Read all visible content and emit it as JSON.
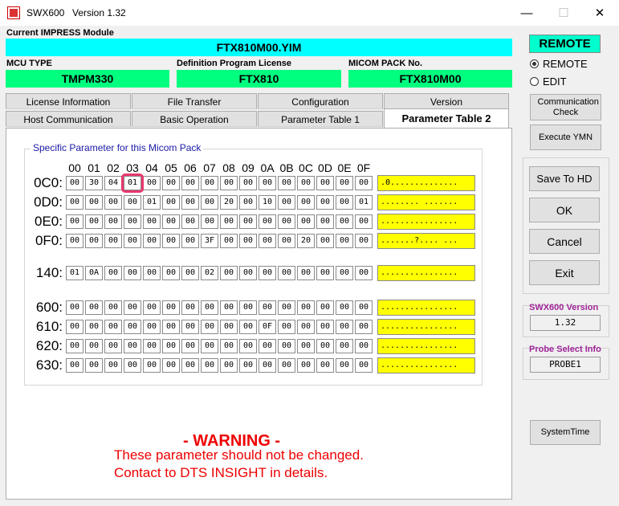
{
  "window": {
    "app_name": "SWX600",
    "version_text": "Version  1.32",
    "minimize": "—",
    "maximize": "☐",
    "close": "✕"
  },
  "impress": {
    "label": "Current IMPRESS Module",
    "value": "FTX810M00.YIM"
  },
  "mcu": {
    "label": "MCU TYPE",
    "value": "TMPM330"
  },
  "license": {
    "label": "Definition Program License",
    "value": "FTX810"
  },
  "micom": {
    "label": "MICOM PACK No.",
    "value": "FTX810M00"
  },
  "tabs_row1": [
    "License Information",
    "File Transfer",
    "Configuration",
    "Version"
  ],
  "tabs_row2": [
    "Host Communication",
    "Basic Operation",
    "Parameter Table 1",
    "Parameter Table 2"
  ],
  "group_title": "Specific Parameter for this Micom Pack",
  "col_headers": [
    "00",
    "01",
    "02",
    "03",
    "04",
    "05",
    "06",
    "07",
    "08",
    "09",
    "0A",
    "0B",
    "0C",
    "0D",
    "0E",
    "0F"
  ],
  "rows": [
    {
      "label": "0C0:",
      "cells": [
        "00",
        "30",
        "04",
        "01",
        "00",
        "00",
        "00",
        "00",
        "00",
        "00",
        "00",
        "00",
        "00",
        "00",
        "00",
        "00"
      ],
      "ascii": ".0..............",
      "highlight": 3
    },
    {
      "label": "0D0:",
      "cells": [
        "00",
        "00",
        "00",
        "00",
        "01",
        "00",
        "00",
        "00",
        "20",
        "00",
        "10",
        "00",
        "00",
        "00",
        "00",
        "01"
      ],
      "ascii": "........ .......",
      "highlight": -1
    },
    {
      "label": "0E0:",
      "cells": [
        "00",
        "00",
        "00",
        "00",
        "00",
        "00",
        "00",
        "00",
        "00",
        "00",
        "00",
        "00",
        "00",
        "00",
        "00",
        "00"
      ],
      "ascii": "................",
      "highlight": -1
    },
    {
      "label": "0F0:",
      "cells": [
        "00",
        "00",
        "00",
        "00",
        "00",
        "00",
        "00",
        "3F",
        "00",
        "00",
        "00",
        "00",
        "20",
        "00",
        "00",
        "00"
      ],
      "ascii": ".......?.... ...",
      "highlight": -1
    },
    {
      "label": "140:",
      "cells": [
        "01",
        "0A",
        "00",
        "00",
        "00",
        "00",
        "00",
        "02",
        "00",
        "00",
        "00",
        "00",
        "00",
        "00",
        "00",
        "00"
      ],
      "ascii": "................",
      "highlight": -1
    },
    {
      "label": "600:",
      "cells": [
        "00",
        "00",
        "00",
        "00",
        "00",
        "00",
        "00",
        "00",
        "00",
        "00",
        "00",
        "00",
        "00",
        "00",
        "00",
        "00"
      ],
      "ascii": "................",
      "highlight": -1
    },
    {
      "label": "610:",
      "cells": [
        "00",
        "00",
        "00",
        "00",
        "00",
        "00",
        "00",
        "00",
        "00",
        "00",
        "0F",
        "00",
        "00",
        "00",
        "00",
        "00"
      ],
      "ascii": "................",
      "highlight": -1
    },
    {
      "label": "620:",
      "cells": [
        "00",
        "00",
        "00",
        "00",
        "00",
        "00",
        "00",
        "00",
        "00",
        "00",
        "00",
        "00",
        "00",
        "00",
        "00",
        "00"
      ],
      "ascii": "................",
      "highlight": -1
    },
    {
      "label": "630:",
      "cells": [
        "00",
        "00",
        "00",
        "00",
        "00",
        "00",
        "00",
        "00",
        "00",
        "00",
        "00",
        "00",
        "00",
        "00",
        "00",
        "00"
      ],
      "ascii": "................",
      "highlight": -1
    }
  ],
  "warning": {
    "title": "- WARNING -",
    "line1": "These parameter should not be changed.",
    "line2": "Contact to DTS INSIGHT in details."
  },
  "right": {
    "mode_badge": "REMOTE",
    "radio_remote": "REMOTE",
    "radio_edit": "EDIT",
    "comm_check": "Communication Check",
    "execute_ymn": "Execute YMN",
    "save_to_hd": "Save To HD",
    "ok": "OK",
    "cancel": "Cancel",
    "exit": "Exit",
    "version_label": "SWX600 Version",
    "version_value": "1.32",
    "probe_label": "Probe Select Info",
    "probe_value": "PROBE1",
    "system_time": "SystemTime"
  },
  "colors": {
    "cyan": "#00ffff",
    "green": "#00ff7f",
    "ascii_bg": "#ffff00",
    "warning": "#ee0000",
    "highlight": "#e8386e"
  }
}
